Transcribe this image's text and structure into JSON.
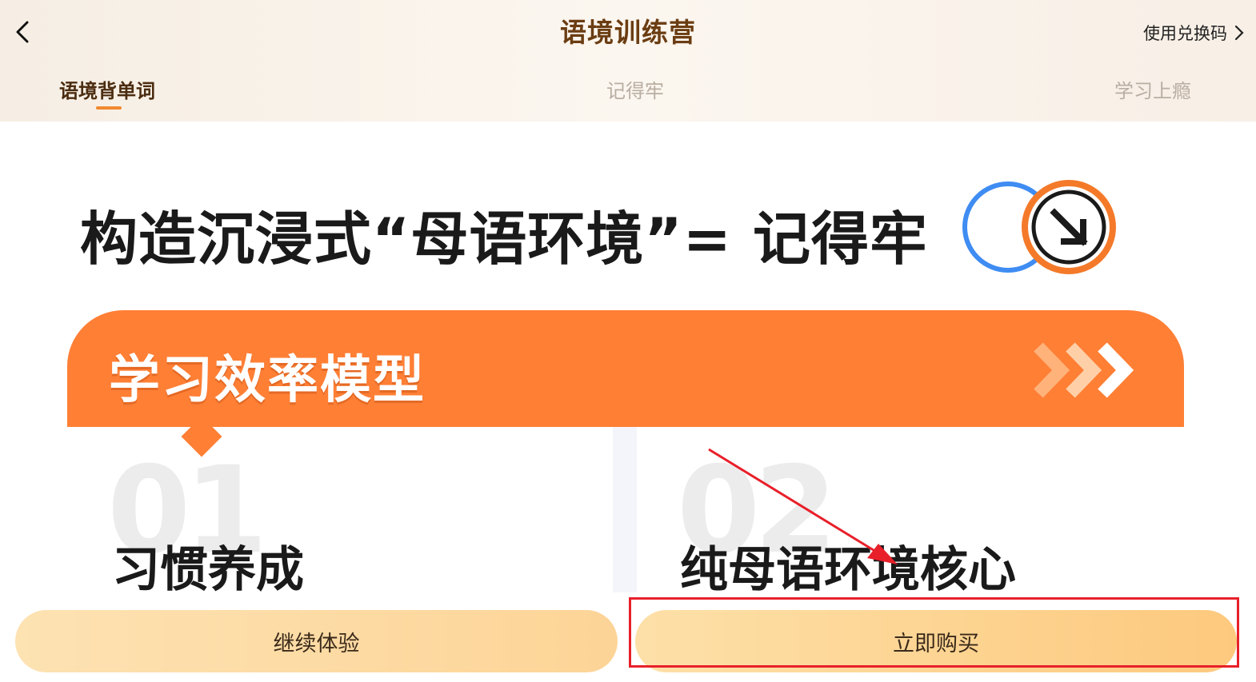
{
  "header": {
    "title": "语境训练营",
    "redeem_label": "使用兑换码",
    "tabs": [
      {
        "label": "语境背单词",
        "active": true
      },
      {
        "label": "记得牢",
        "active": false
      },
      {
        "label": "学习上瘾",
        "active": false
      }
    ]
  },
  "hero": {
    "headline": "构造沉浸式“母语环境”= 记得牢"
  },
  "card": {
    "title": "学习效率模型",
    "items": [
      {
        "number": "01",
        "title": "习惯养成"
      },
      {
        "number": "02",
        "title": "纯母语环境核心"
      }
    ]
  },
  "actions": {
    "continue_label": "继续体验",
    "buy_label": "立即购买"
  },
  "colors": {
    "accent_orange": "#ff7f35",
    "title_brown": "#6b3d12",
    "button_gold": "#fdc97e",
    "annotation_red": "#e8202a"
  }
}
